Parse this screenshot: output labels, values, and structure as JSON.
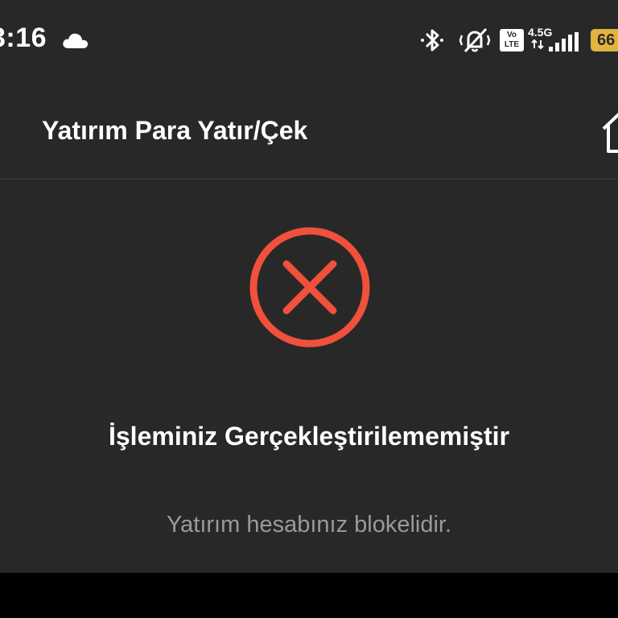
{
  "status_bar": {
    "time": "3:16",
    "network": "4.5G",
    "volte": [
      "Vo",
      "LTE"
    ],
    "battery": "66",
    "icons": [
      "cloud-icon",
      "bluetooth-icon",
      "vibrate-mute-icon",
      "volte-icon",
      "signal-icon",
      "battery-icon"
    ]
  },
  "header": {
    "title": "Yatırım Para Yatır/Çek",
    "home_icon": "home-icon"
  },
  "result": {
    "icon": "error-x-icon",
    "icon_color": "#f0503c",
    "title": "İşleminiz Gerçekleştirilememiştir",
    "message": "Yatırım hesabınız blokelidir."
  },
  "colors": {
    "background": "#282828",
    "text_primary": "#ffffff",
    "text_secondary": "#9a9a9a",
    "error": "#f0503c",
    "battery": "#e3b53c"
  }
}
